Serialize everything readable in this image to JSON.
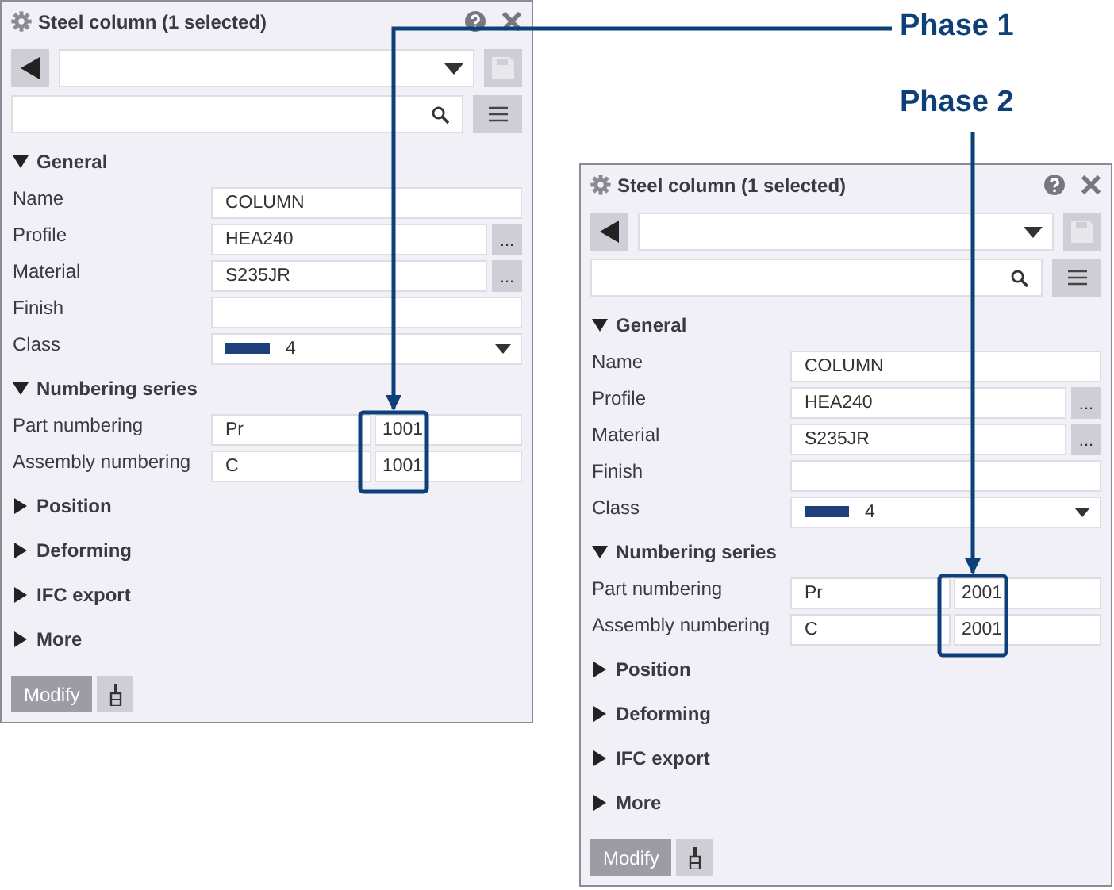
{
  "callouts": [
    {
      "label": "Phase 1"
    },
    {
      "label": "Phase 2"
    }
  ],
  "panels": [
    {
      "title": "Steel column (1 selected)",
      "sections": [
        {
          "title": "General",
          "expanded": true,
          "rows": [
            {
              "kind": "text",
              "label": "Name",
              "value": "COLUMN"
            },
            {
              "kind": "browse",
              "label": "Profile",
              "value": "HEA240",
              "button": "..."
            },
            {
              "kind": "browse",
              "label": "Material",
              "value": "S235JR",
              "button": "..."
            },
            {
              "kind": "text",
              "label": "Finish"
            },
            {
              "kind": "class",
              "label": "Class",
              "value": "4",
              "color": "#1f3f7a"
            }
          ]
        },
        {
          "title": "Numbering series",
          "expanded": true,
          "rows": [
            {
              "kind": "pair",
              "label": "Part numbering",
              "prefix": "Pr",
              "number": "1001"
            },
            {
              "kind": "pair",
              "label": "Assembly numbering",
              "prefix": "C",
              "number": "1001"
            }
          ]
        },
        {
          "title": "Position",
          "expanded": false
        },
        {
          "title": "Deforming",
          "expanded": false
        },
        {
          "title": "IFC export",
          "expanded": false
        },
        {
          "title": "More",
          "expanded": false
        }
      ],
      "modify": {
        "label": "Modify",
        "disabled": true
      }
    },
    {
      "title": "Steel column (1 selected)",
      "sections": [
        {
          "title": "General",
          "expanded": true,
          "rows": [
            {
              "kind": "text",
              "label": "Name",
              "value": "COLUMN"
            },
            {
              "kind": "browse",
              "label": "Profile",
              "value": "HEA240",
              "button": "..."
            },
            {
              "kind": "browse",
              "label": "Material",
              "value": "S235JR",
              "button": "..."
            },
            {
              "kind": "text",
              "label": "Finish"
            },
            {
              "kind": "class",
              "label": "Class",
              "value": "4",
              "color": "#1f3f7a"
            }
          ]
        },
        {
          "title": "Numbering series",
          "expanded": true,
          "rows": [
            {
              "kind": "pair",
              "label": "Part numbering",
              "prefix": "Pr",
              "number": "2001"
            },
            {
              "kind": "pair",
              "label": "Assembly numbering",
              "prefix": "C",
              "number": "2001"
            }
          ]
        },
        {
          "title": "Position",
          "expanded": false
        },
        {
          "title": "Deforming",
          "expanded": false
        },
        {
          "title": "IFC export",
          "expanded": false
        },
        {
          "title": "More",
          "expanded": false
        }
      ],
      "modify": {
        "label": "Modify",
        "disabled": true
      }
    }
  ]
}
